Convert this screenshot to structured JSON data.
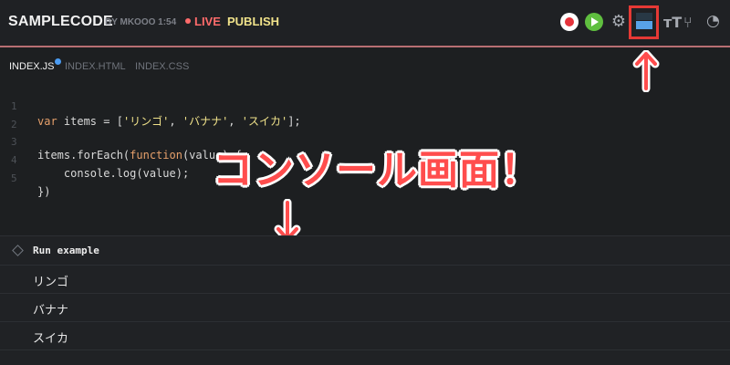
{
  "header": {
    "title": "SAMPLECODE",
    "byline": "BY MKOOO 1:54",
    "live_label": "LIVE",
    "publish_label": "PUBLISH",
    "icons": [
      "record-icon",
      "play-icon",
      "gear-icon",
      "console-panel-icon",
      "text-size-icon",
      "fork-icon",
      "timer-icon"
    ],
    "highlight_color": "#e53935"
  },
  "tabs": [
    {
      "label": "INDEX.JS",
      "active": true,
      "modified": true
    },
    {
      "label": "INDEX.HTML",
      "active": false
    },
    {
      "label": "INDEX.CSS",
      "active": false
    }
  ],
  "code": {
    "line_numbers": [
      "1",
      "2",
      "3",
      "4",
      "5"
    ],
    "lines": [
      "var items = ['リンゴ', 'バナナ', 'スイカ'];",
      "",
      "items.forEach(function(value) {",
      "    console.log(value);",
      "})"
    ]
  },
  "annotation": {
    "text": "コンソール画面！",
    "color": "#ff4d4d"
  },
  "console": {
    "header": "Run example",
    "outputs": [
      "リンゴ",
      "バナナ",
      "スイカ"
    ]
  }
}
